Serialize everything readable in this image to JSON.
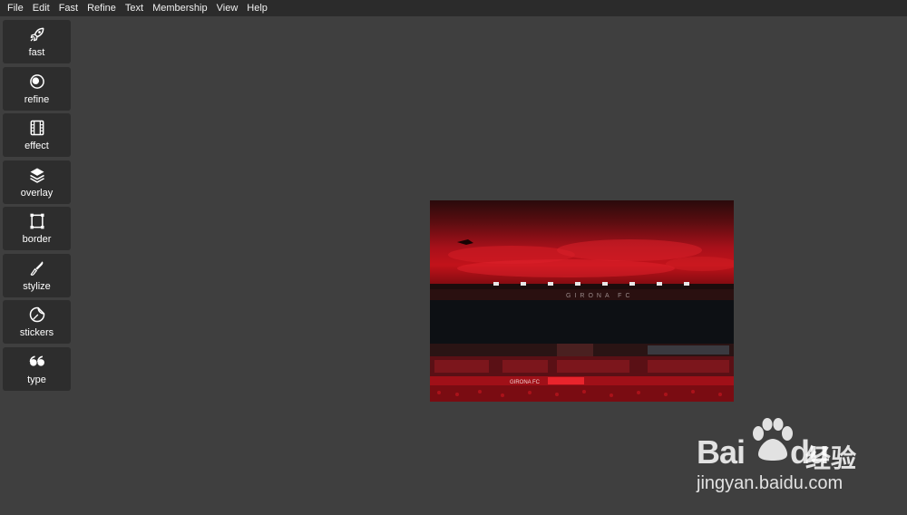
{
  "menubar": {
    "items": [
      "File",
      "Edit",
      "Fast",
      "Refine",
      "Text",
      "Membership",
      "View",
      "Help"
    ]
  },
  "toolbar": {
    "tools": [
      {
        "label": "fast",
        "icon": "rocket-icon"
      },
      {
        "label": "refine",
        "icon": "refine-circles-icon"
      },
      {
        "label": "effect",
        "icon": "film-strip-icon"
      },
      {
        "label": "overlay",
        "icon": "layers-icon"
      },
      {
        "label": "border",
        "icon": "border-frame-icon"
      },
      {
        "label": "stylize",
        "icon": "brush-icon"
      },
      {
        "label": "stickers",
        "icon": "sticker-icon"
      },
      {
        "label": "type",
        "icon": "quote-icon"
      }
    ]
  },
  "canvas": {
    "image_text": "GIRONA FC",
    "banner_text": "GIRONA FC"
  },
  "watermark": {
    "logo": "Bai",
    "logo_end": "du",
    "cn": "经验",
    "url": "jingyan.baidu.com"
  },
  "colors": {
    "background": "#3f3f3f",
    "menubar": "#2b2b2b",
    "tool": "#2d2d2d",
    "stadium_red": "#c2121a"
  }
}
